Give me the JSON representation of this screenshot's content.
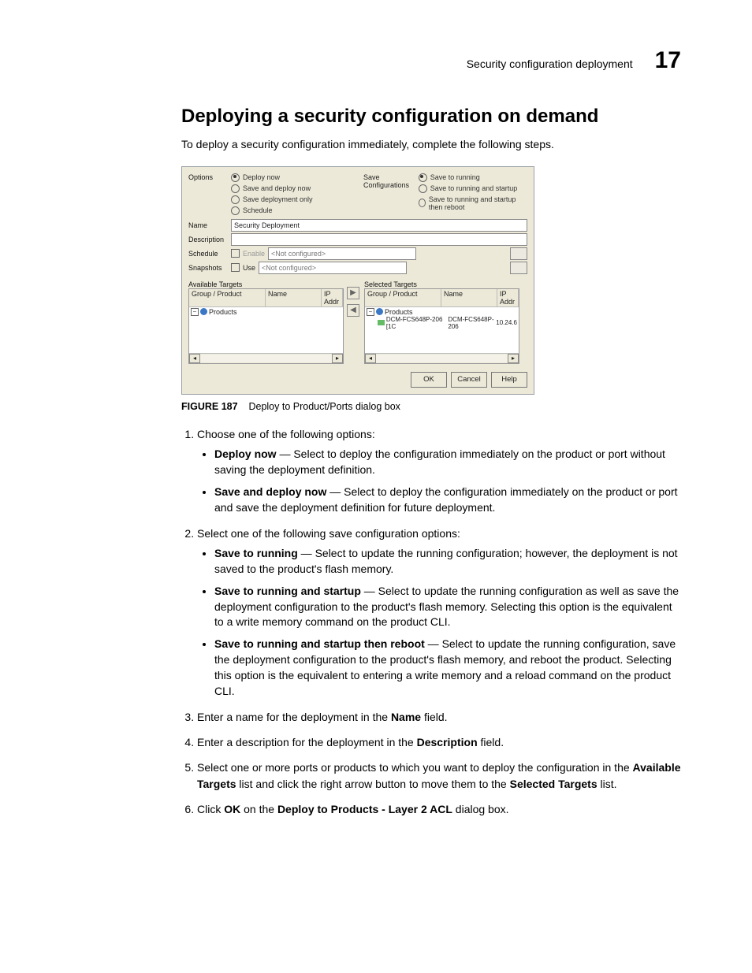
{
  "header": {
    "title": "Security configuration deployment",
    "chapter": "17"
  },
  "page": {
    "heading": "Deploying a security configuration on demand",
    "intro": "To deploy a security configuration immediately, complete the following steps."
  },
  "figure": {
    "caption_label": "FIGURE 187",
    "caption_text": "Deploy to Product/Ports dialog box"
  },
  "dlg": {
    "labels": {
      "options": "Options",
      "save_cfg": "Save Configurations",
      "name": "Name",
      "description": "Description",
      "schedule": "Schedule",
      "snapshots": "Snapshots",
      "available": "Available Targets",
      "selected": "Selected Targets"
    },
    "options": {
      "deploy_now": "Deploy now",
      "save_deploy_now": "Save and deploy now",
      "save_only": "Save deployment only",
      "schedule": "Schedule"
    },
    "save_config": {
      "running": "Save to running",
      "running_startup": "Save to running and startup",
      "running_startup_reboot": "Save to running and startup then reboot"
    },
    "fields": {
      "name_value": "Security Deployment",
      "schedule_enable": "Enable",
      "schedule_value": "<Not configured>",
      "snapshot_use": "Use",
      "snapshot_value": "<Not configured>"
    },
    "cols": {
      "group": "Group / Product",
      "name": "Name",
      "ip": "IP Addr"
    },
    "tree": {
      "products": "Products",
      "device_group": "DCM-FCS648P-206 [1C",
      "device_name": "DCM-FCS648P-206",
      "device_ip": "10.24.6"
    },
    "buttons": {
      "ok": "OK",
      "cancel": "Cancel",
      "help": "Help"
    }
  },
  "steps": {
    "s1": "Choose one of the following options:",
    "s1a_b": "Deploy now",
    "s1a_t": " — Select to deploy the configuration immediately on the product or port without saving the deployment definition.",
    "s1b_b": "Save and deploy now",
    "s1b_t": " — Select to deploy the configuration immediately on the product or port and save the deployment definition for future deployment.",
    "s2": "Select one of the following save configuration options:",
    "s2a_b": "Save to running",
    "s2a_t": " — Select to update the running configuration; however, the deployment is not saved to the product's flash memory.",
    "s2b_b": "Save to running and startup",
    "s2b_t": " — Select to update the running configuration as well as save the deployment configuration to the product's flash memory. Selecting this option is the equivalent to a write memory command on the product CLI.",
    "s2c_b": "Save to running and startup then reboot",
    "s2c_t": " — Select to update the running configuration, save the deployment configuration to the product's flash memory, and reboot the product. Selecting this option is the equivalent to entering a write memory and a reload command on the product CLI.",
    "s3_a": "Enter a name for the deployment in the ",
    "s3_b": "Name",
    "s3_c": " field.",
    "s4_a": "Enter a description for the deployment in the ",
    "s4_b": "Description",
    "s4_c": " field.",
    "s5_a": "Select one or more ports or products to which you want to deploy the configuration in the ",
    "s5_b": "Available Targets",
    "s5_c": " list and click the right arrow button to move them to the ",
    "s5_d": "Selected Targets",
    "s5_e": " list.",
    "s6_a": "Click ",
    "s6_b": "OK",
    "s6_c": " on the ",
    "s6_d": "Deploy to Products - Layer 2 ACL",
    "s6_e": " dialog box."
  }
}
